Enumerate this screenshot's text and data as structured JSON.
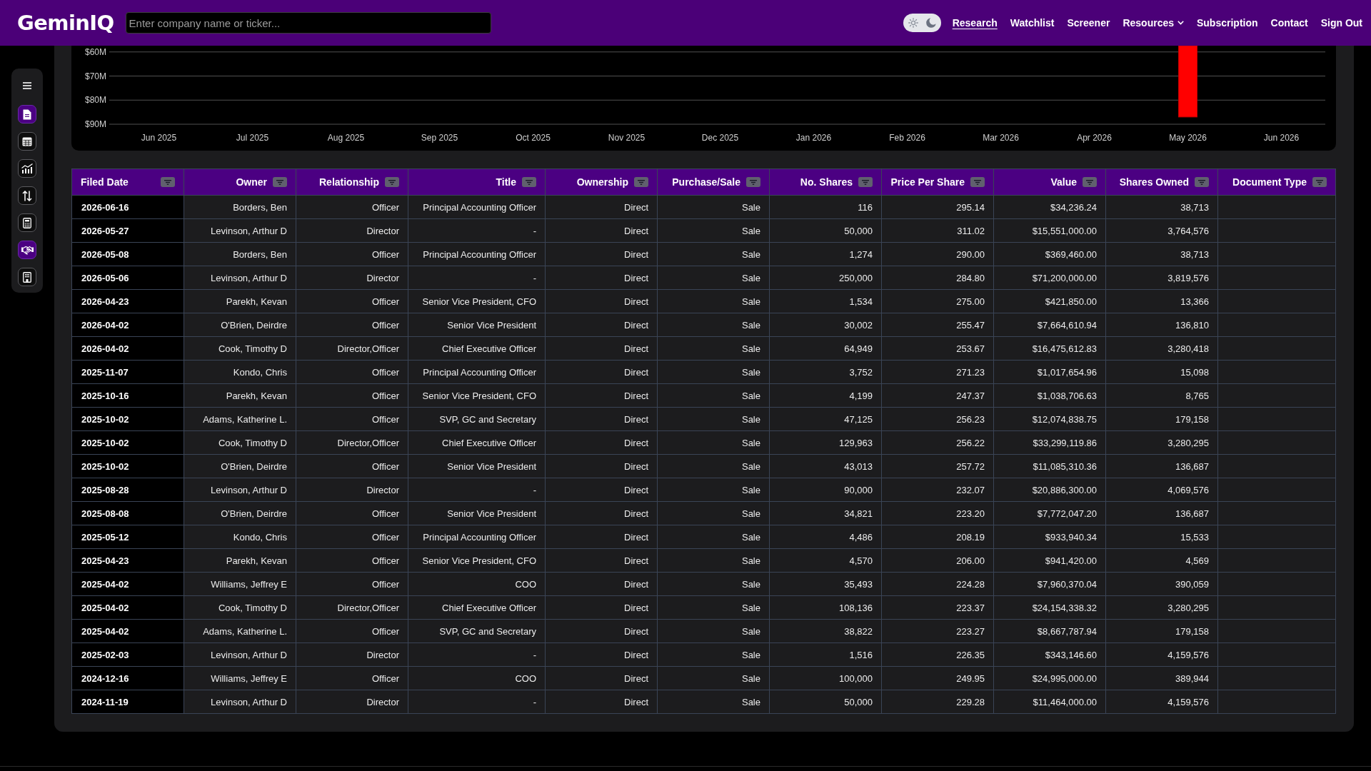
{
  "header": {
    "logo": "GeminIQ",
    "search": {
      "placeholder": "Enter company name or ticker..."
    },
    "theme_toggle": {
      "dark": true
    },
    "nav": [
      {
        "label": "Research",
        "kind": "link",
        "selected": true
      },
      {
        "label": "Watchlist",
        "kind": "link",
        "selected": false
      },
      {
        "label": "Screener",
        "kind": "link",
        "selected": false
      },
      {
        "label": "Resources",
        "kind": "dropdown",
        "selected": false
      },
      {
        "label": "Subscription",
        "kind": "link",
        "selected": false
      },
      {
        "label": "Contact",
        "kind": "link",
        "selected": false
      },
      {
        "label": "Sign Out",
        "kind": "link",
        "selected": false
      }
    ]
  },
  "sidebar": {
    "items": [
      {
        "selected": true
      },
      {
        "selected": false
      },
      {
        "selected": false
      },
      {
        "selected": false
      },
      {
        "selected": false
      },
      {
        "selected": true
      },
      {
        "selected": false
      }
    ]
  },
  "chart": {
    "chart_data": {
      "type": "bar",
      "categories": [
        "Jun 2025",
        "Jul 2025",
        "Aug 2025",
        "Sep 2025",
        "Oct 2025",
        "Nov 2025",
        "Dec 2025",
        "Jan 2026",
        "Feb 2026",
        "Mar 2026",
        "Apr 2026",
        "May 2026",
        "Jun 2026"
      ],
      "values": [
        null,
        null,
        null,
        null,
        null,
        null,
        null,
        null,
        null,
        null,
        null,
        87,
        null
      ],
      "ylim": [
        90,
        58
      ],
      "yticks": [
        {
          "value": 60,
          "label": "$60M"
        },
        {
          "value": 70,
          "label": "$70M"
        },
        {
          "value": 80,
          "label": "$80M"
        },
        {
          "value": 90,
          "label": "$90M"
        }
      ],
      "grid": true
    }
  },
  "table": {
    "columns": [
      {
        "label": "Filed Date"
      },
      {
        "label": "Owner"
      },
      {
        "label": "Relationship"
      },
      {
        "label": "Title"
      },
      {
        "label": "Ownership"
      },
      {
        "label": "Purchase/Sale"
      },
      {
        "label": "No. Shares"
      },
      {
        "label": "Price Per Share"
      },
      {
        "label": "Value"
      },
      {
        "label": "Shares Owned"
      },
      {
        "label": "Document Type"
      }
    ],
    "rows": [
      [
        "2026-06-16",
        "Borders, Ben",
        "Officer",
        "Principal Accounting Officer",
        "Direct",
        "Sale",
        "116",
        "295.14",
        "$34,236.24",
        "38,713"
      ],
      [
        "2026-05-27",
        "Levinson, Arthur D",
        "Director",
        "-",
        "Direct",
        "Sale",
        "50,000",
        "311.02",
        "$15,551,000.00",
        "3,764,576"
      ],
      [
        "2026-05-08",
        "Borders, Ben",
        "Officer",
        "Principal Accounting Officer",
        "Direct",
        "Sale",
        "1,274",
        "290.00",
        "$369,460.00",
        "38,713"
      ],
      [
        "2026-05-06",
        "Levinson, Arthur D",
        "Director",
        "-",
        "Direct",
        "Sale",
        "250,000",
        "284.80",
        "$71,200,000.00",
        "3,819,576"
      ],
      [
        "2026-04-23",
        "Parekh, Kevan",
        "Officer",
        "Senior Vice President, CFO",
        "Direct",
        "Sale",
        "1,534",
        "275.00",
        "$421,850.00",
        "13,366"
      ],
      [
        "2026-04-02",
        "O'Brien, Deirdre",
        "Officer",
        "Senior Vice President",
        "Direct",
        "Sale",
        "30,002",
        "255.47",
        "$7,664,610.94",
        "136,810"
      ],
      [
        "2026-04-02",
        "Cook, Timothy D",
        "Director,Officer",
        "Chief Executive Officer",
        "Direct",
        "Sale",
        "64,949",
        "253.67",
        "$16,475,612.83",
        "3,280,418"
      ],
      [
        "2025-11-07",
        "Kondo, Chris",
        "Officer",
        "Principal Accounting Officer",
        "Direct",
        "Sale",
        "3,752",
        "271.23",
        "$1,017,654.96",
        "15,098"
      ],
      [
        "2025-10-16",
        "Parekh, Kevan",
        "Officer",
        "Senior Vice President, CFO",
        "Direct",
        "Sale",
        "4,199",
        "247.37",
        "$1,038,706.63",
        "8,765"
      ],
      [
        "2025-10-02",
        "Adams, Katherine L.",
        "Officer",
        "SVP, GC and Secretary",
        "Direct",
        "Sale",
        "47,125",
        "256.23",
        "$12,074,838.75",
        "179,158"
      ],
      [
        "2025-10-02",
        "Cook, Timothy D",
        "Director,Officer",
        "Chief Executive Officer",
        "Direct",
        "Sale",
        "129,963",
        "256.22",
        "$33,299,119.86",
        "3,280,295"
      ],
      [
        "2025-10-02",
        "O'Brien, Deirdre",
        "Officer",
        "Senior Vice President",
        "Direct",
        "Sale",
        "43,013",
        "257.72",
        "$11,085,310.36",
        "136,687"
      ],
      [
        "2025-08-28",
        "Levinson, Arthur D",
        "Director",
        "-",
        "Direct",
        "Sale",
        "90,000",
        "232.07",
        "$20,886,300.00",
        "4,069,576"
      ],
      [
        "2025-08-08",
        "O'Brien, Deirdre",
        "Officer",
        "Senior Vice President",
        "Direct",
        "Sale",
        "34,821",
        "223.20",
        "$7,772,047.20",
        "136,687"
      ],
      [
        "2025-05-12",
        "Kondo, Chris",
        "Officer",
        "Principal Accounting Officer",
        "Direct",
        "Sale",
        "4,486",
        "208.19",
        "$933,940.34",
        "15,533"
      ],
      [
        "2025-04-23",
        "Parekh, Kevan",
        "Officer",
        "Senior Vice President, CFO",
        "Direct",
        "Sale",
        "4,570",
        "206.00",
        "$941,420.00",
        "4,569"
      ],
      [
        "2025-04-02",
        "Williams, Jeffrey E",
        "Officer",
        "COO",
        "Direct",
        "Sale",
        "35,493",
        "224.28",
        "$7,960,370.04",
        "390,059"
      ],
      [
        "2025-04-02",
        "Cook, Timothy D",
        "Director,Officer",
        "Chief Executive Officer",
        "Direct",
        "Sale",
        "108,136",
        "223.37",
        "$24,154,338.32",
        "3,280,295"
      ],
      [
        "2025-04-02",
        "Adams, Katherine L.",
        "Officer",
        "SVP, GC and Secretary",
        "Direct",
        "Sale",
        "38,822",
        "223.27",
        "$8,667,787.94",
        "179,158"
      ],
      [
        "2025-02-03",
        "Levinson, Arthur D",
        "Director",
        "-",
        "Direct",
        "Sale",
        "1,516",
        "226.35",
        "$343,146.60",
        "4,159,576"
      ],
      [
        "2024-12-16",
        "Williams, Jeffrey E",
        "Officer",
        "COO",
        "Direct",
        "Sale",
        "100,000",
        "249.95",
        "$24,995,000.00",
        "389,944"
      ],
      [
        "2024-11-19",
        "Levinson, Arthur D",
        "Director",
        "-",
        "Direct",
        "Sale",
        "50,000",
        "229.28",
        "$11,464,000.00",
        "4,159,576"
      ]
    ]
  }
}
